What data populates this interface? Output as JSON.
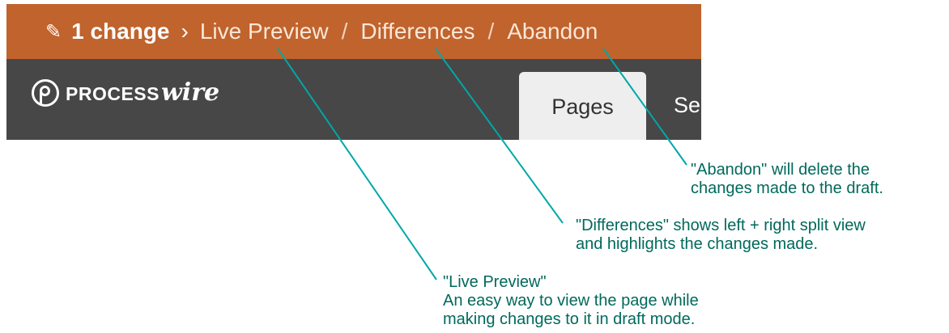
{
  "draft_bar": {
    "icon": "paperclip-icon",
    "change_count": "1 change",
    "chevron": "›",
    "live_preview": "Live Preview",
    "separator": "/",
    "differences": "Differences",
    "abandon": "Abandon",
    "background": "#c0632d"
  },
  "admin_bar": {
    "logo_word_a": "PROCESS",
    "logo_word_b": "wire",
    "tabs": [
      "Pages",
      "Se"
    ],
    "background": "#474747"
  },
  "callouts": {
    "abandon": [
      "\"Abandon\" will delete the",
      "changes made to the draft."
    ],
    "differences": [
      "\"Differences\" shows left + right split view",
      "and highlights the changes made."
    ],
    "live_preview": [
      "\"Live Preview\"",
      "An easy way to view the page while",
      "making changes to it in draft mode."
    ],
    "color": "#00695c",
    "line_color": "#00a7a7"
  }
}
